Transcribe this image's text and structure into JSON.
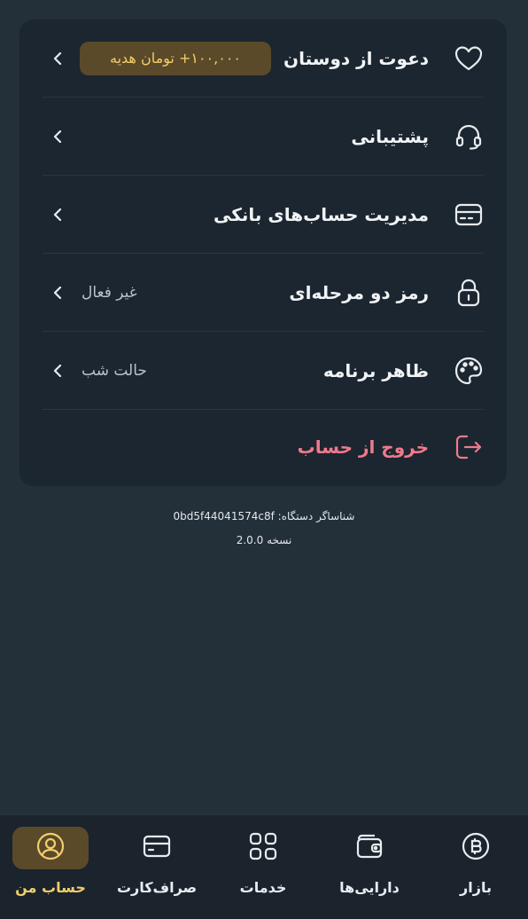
{
  "menu": {
    "invite": {
      "label": "دعوت از دوستان",
      "badge": "۱۰۰,۰۰۰+ تومان هدیه",
      "icon": "heart-icon"
    },
    "support": {
      "label": "پشتیبانی",
      "icon": "headset-icon"
    },
    "bank_accounts": {
      "label": "مدیریت حساب‌های بانکی",
      "icon": "card-icon"
    },
    "two_factor": {
      "label": "رمز دو مرحله‌ای",
      "value": "غیر فعال",
      "icon": "lock-icon"
    },
    "appearance": {
      "label": "ظاهر برنامه",
      "value": "حالت شب",
      "icon": "palette-icon"
    },
    "logout": {
      "label": "خروج از حساب",
      "icon": "logout-icon"
    }
  },
  "device_info": {
    "device_id": "شناساگر دستگاه: 0bd5f44041574c8f",
    "version": "نسخه 2.0.0"
  },
  "bottom_nav": {
    "items": [
      {
        "label": "حساب من",
        "icon": "user-circle-icon",
        "active": true
      },
      {
        "label": "صراف‌کارت",
        "icon": "card-icon",
        "active": false
      },
      {
        "label": "خدمات",
        "icon": "grid-icon",
        "active": false
      },
      {
        "label": "دارایی‌ها",
        "icon": "wallet-icon",
        "active": false
      },
      {
        "label": "بازار",
        "icon": "coin-icon",
        "active": false
      }
    ]
  },
  "colors": {
    "background": "#232f39",
    "card": "#1c2630",
    "accent_gold": "#f3cd6a",
    "danger": "#f07a8c"
  }
}
